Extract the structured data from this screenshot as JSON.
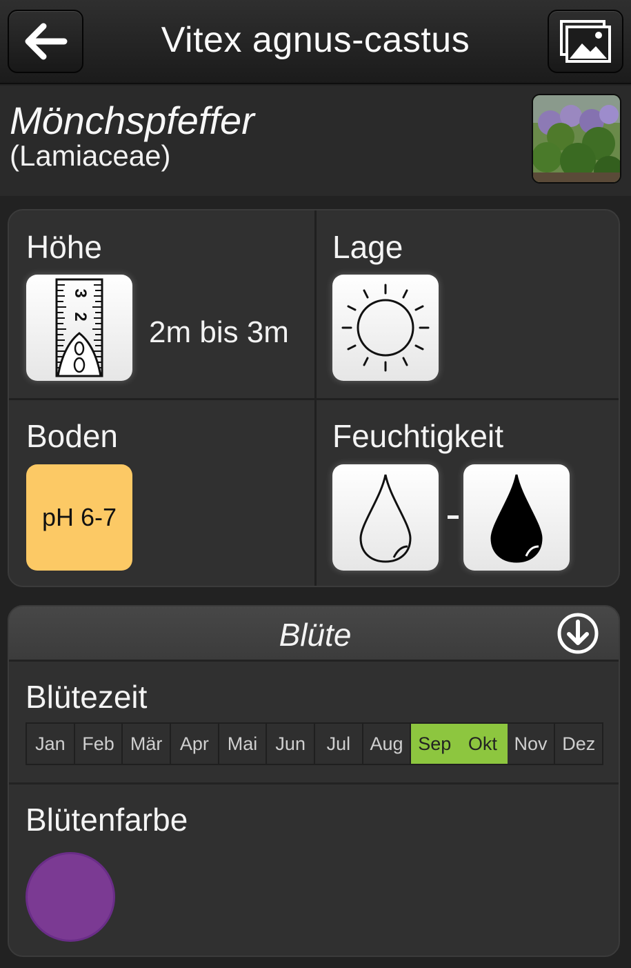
{
  "header": {
    "title": "Vitex agnus-castus",
    "back_icon": "back-arrow-icon",
    "gallery_icon": "image-gallery-icon"
  },
  "plant": {
    "common_name": "Mönchspfeffer",
    "family": "(Lamiaceae)"
  },
  "info": {
    "height": {
      "label": "Höhe",
      "value": "2m bis 3m",
      "icon": "ruler-icon"
    },
    "location": {
      "label": "Lage",
      "icon": "sun-icon"
    },
    "soil": {
      "label": "Boden",
      "ph": "pH 6-7",
      "color": "#fcc965"
    },
    "moisture": {
      "label": "Feuchtigkeit",
      "icons": [
        "drop-outline-icon",
        "drop-filled-icon"
      ]
    }
  },
  "bloom": {
    "title": "Blüte",
    "collapse_icon": "arrow-down-circle-icon",
    "time_label": "Blütezeit",
    "months": [
      {
        "label": "Jan",
        "active": false
      },
      {
        "label": "Feb",
        "active": false
      },
      {
        "label": "Mär",
        "active": false
      },
      {
        "label": "Apr",
        "active": false
      },
      {
        "label": "Mai",
        "active": false
      },
      {
        "label": "Jun",
        "active": false
      },
      {
        "label": "Jul",
        "active": false
      },
      {
        "label": "Aug",
        "active": false
      },
      {
        "label": "Sep",
        "active": true
      },
      {
        "label": "Okt",
        "active": true
      },
      {
        "label": "Nov",
        "active": false
      },
      {
        "label": "Dez",
        "active": false
      }
    ],
    "active_color": "#8dc63f",
    "color_label": "Blütenfarbe",
    "flower_color": "#7b3a93"
  }
}
